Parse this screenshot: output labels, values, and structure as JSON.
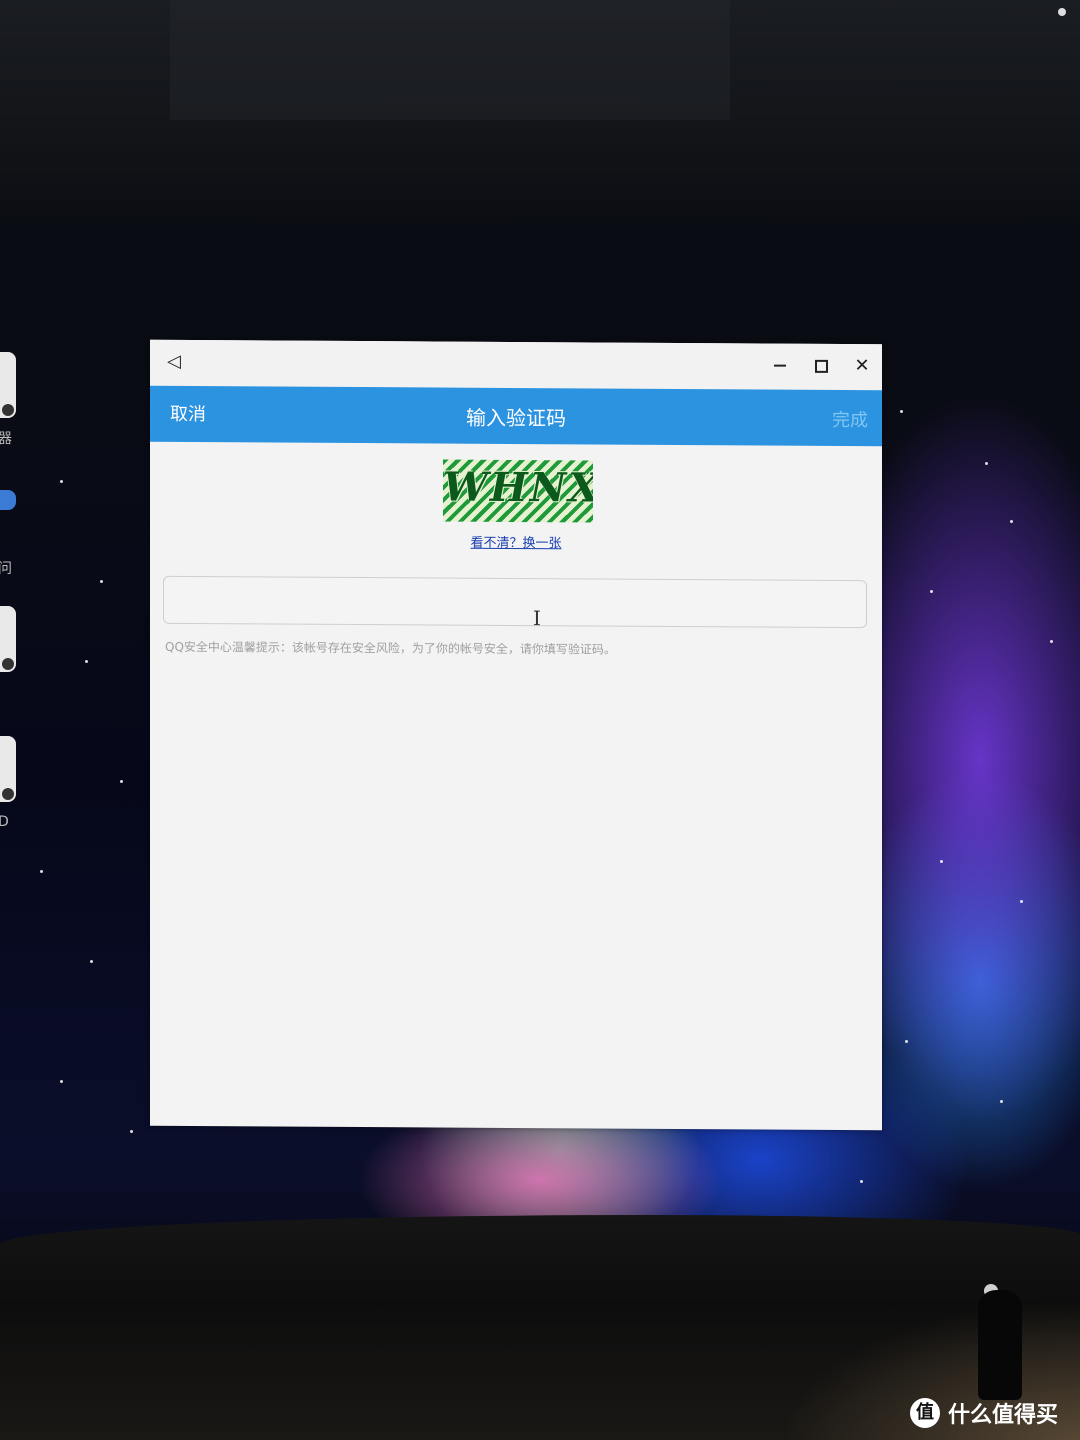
{
  "window": {
    "back_glyph": "◁",
    "close_glyph": "✕"
  },
  "header": {
    "cancel_label": "取消",
    "title": "输入验证码",
    "done_label": "完成"
  },
  "captcha": {
    "image_text": "WHNX",
    "refresh_link": "看不清？换一张"
  },
  "input": {
    "value": ""
  },
  "hint": "QQ安全中心温馨提示：该帐号存在安全风险，为了你的帐号安全，请你填写验证码。",
  "desktop": {
    "left_labels": [
      "器",
      "问",
      "D"
    ]
  },
  "watermark": {
    "icon_glyph": "值",
    "text": "什么值得买"
  },
  "colors": {
    "header_blue": "#2c93e0",
    "done_inactive": "#7fc6f2",
    "link_blue": "#1a3fb0"
  }
}
